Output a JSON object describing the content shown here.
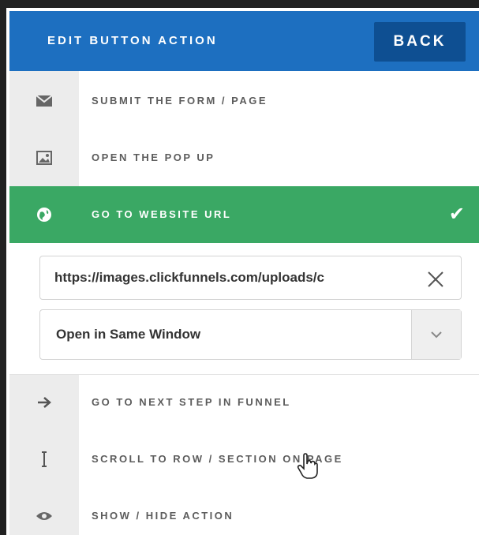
{
  "header": {
    "title": "EDIT BUTTON ACTION",
    "back_label": "BACK"
  },
  "actions": [
    {
      "label": "SUBMIT THE FORM / PAGE",
      "icon": "envelope-icon"
    },
    {
      "label": "OPEN THE POP UP",
      "icon": "image-icon"
    },
    {
      "label": "GO TO WEBSITE URL",
      "icon": "globe-icon",
      "selected": true
    },
    {
      "label": "GO TO NEXT STEP IN FUNNEL",
      "icon": "arrow-right-icon"
    },
    {
      "label": "SCROLL TO ROW / SECTION ON PAGE",
      "icon": "scroll-icon"
    },
    {
      "label": "SHOW / HIDE ACTION",
      "icon": "eye-icon"
    }
  ],
  "url_field": {
    "value": "https://images.clickfunnels.com/uploads/c"
  },
  "target_select": {
    "selected": "Open in Same Window"
  },
  "colors": {
    "header_bg": "#1d6fc0",
    "back_bg": "#0e4f92",
    "active_bg": "#3aa864"
  }
}
